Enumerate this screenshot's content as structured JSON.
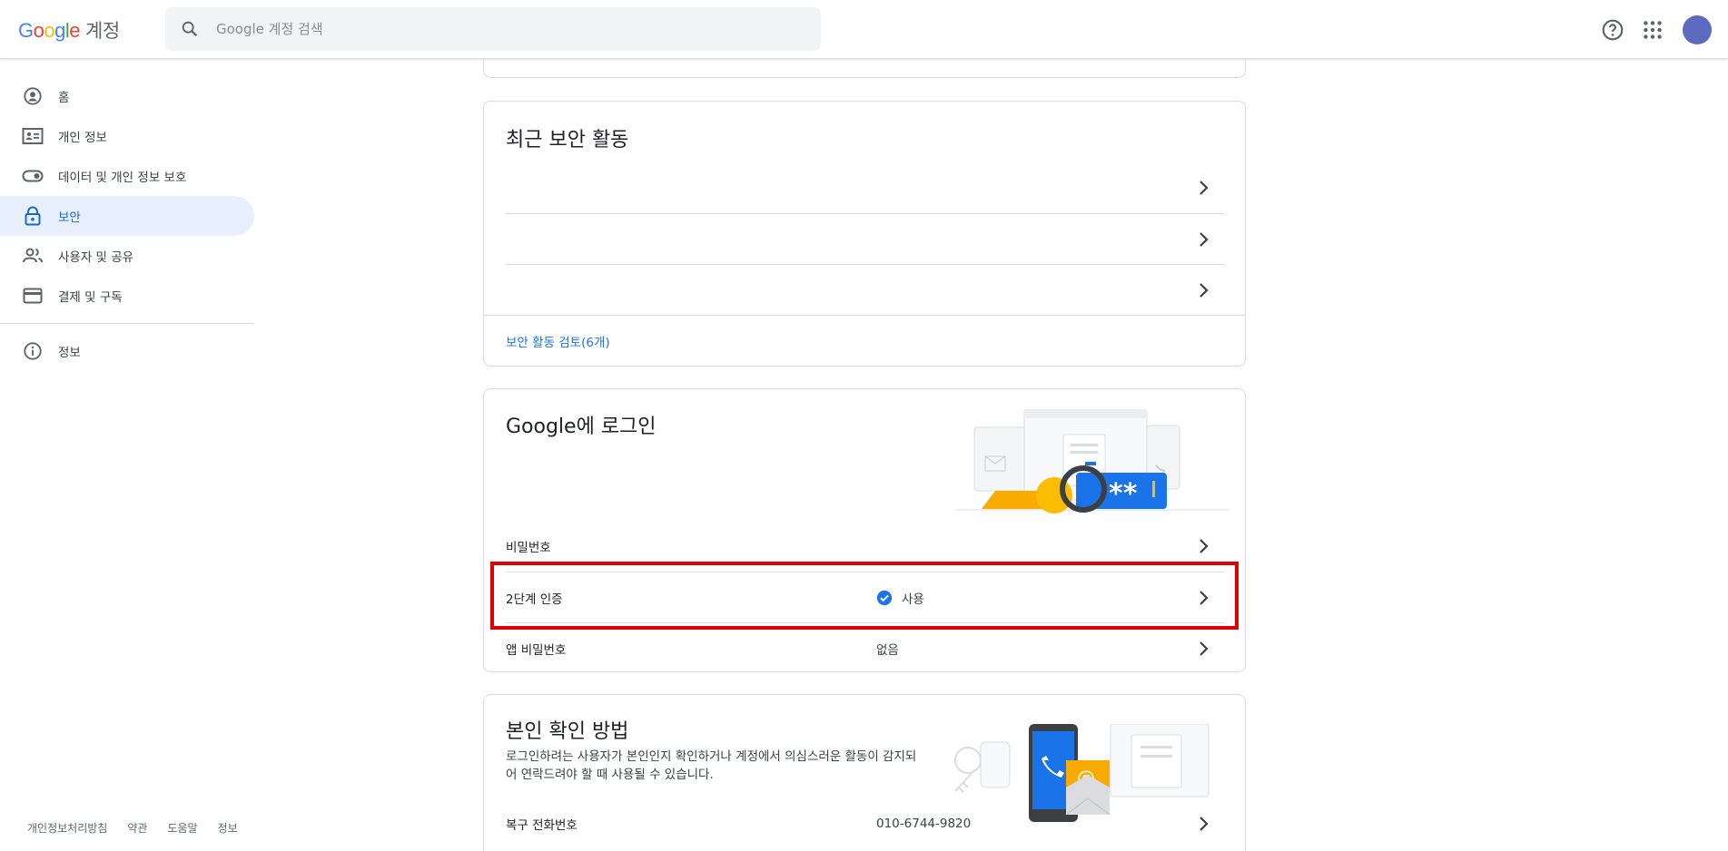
{
  "header": {
    "logo_letters": [
      "G",
      "o",
      "o",
      "g",
      "l",
      "e"
    ],
    "logo_suffix": "계정",
    "search_placeholder": "Google 계정 검색"
  },
  "nav": {
    "items": [
      {
        "label": "홈",
        "icon": "account-circle-icon"
      },
      {
        "label": "개인 정보",
        "icon": "id-card-icon"
      },
      {
        "label": "데이터 및 개인 정보 보호",
        "icon": "toggle-icon"
      },
      {
        "label": "보안",
        "icon": "lock-icon",
        "active": true
      },
      {
        "label": "사용자 및 공유",
        "icon": "people-icon"
      },
      {
        "label": "결제 및 구독",
        "icon": "credit-card-icon"
      }
    ],
    "about": {
      "label": "정보",
      "icon": "info-icon"
    }
  },
  "footer": {
    "links": [
      "개인정보처리방침",
      "약관",
      "도움말",
      "정보"
    ]
  },
  "recent_activity": {
    "title": "최근 보안 활동",
    "review_link": "보안 활동 검토(6개)"
  },
  "signin": {
    "title": "Google에 로그인",
    "password_label": "비밀번호",
    "two_step_label": "2단계 인증",
    "two_step_value": "사용",
    "app_password_label": "앱 비밀번호",
    "app_password_value": "없음",
    "illustration_text": "**"
  },
  "verify": {
    "title": "본인 확인 방법",
    "description": "로그인하려는 사용자가 본인인지 확인하거나 계정에서 의심스러운 활동이 감지되어 연락드려야 할 때 사용될 수 있습니다.",
    "recovery_phone_label": "복구 전화번호",
    "recovery_phone_value": "010-6744-9820"
  },
  "colors": {
    "accent": "#1a73e8",
    "active_bg": "#e8f0fe",
    "highlight": "#e00000",
    "avatar": "#5c6bc0"
  }
}
